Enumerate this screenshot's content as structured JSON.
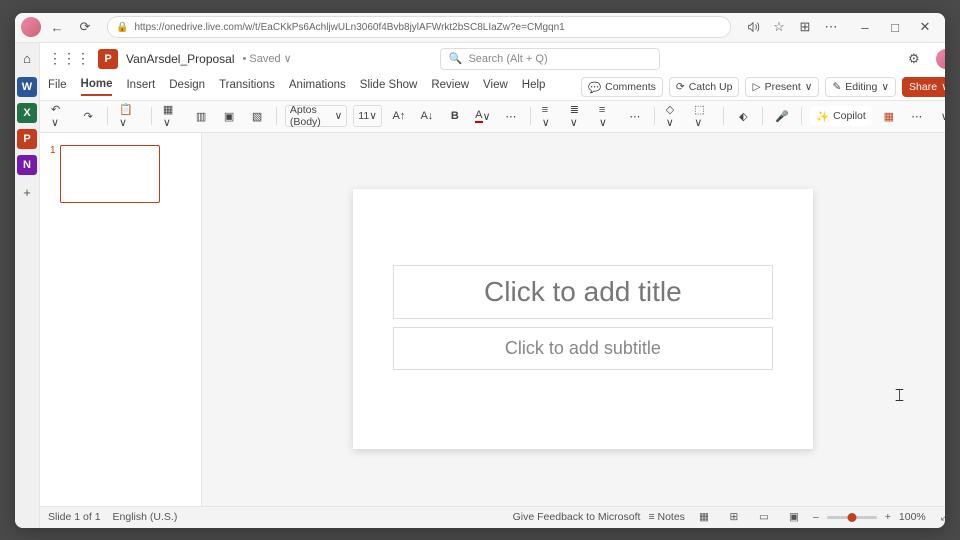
{
  "browser": {
    "url": "https://onedrive.live.com/w/t/EaCKkPs6AchljwULn3060f4Bvb8jylAFWrkt2bSC8LIaZw?e=CMgqn1"
  },
  "sidebar_apps": [
    {
      "label": "W",
      "color": "#2b579a"
    },
    {
      "label": "X",
      "color": "#217346"
    },
    {
      "label": "P",
      "color": "#c43e1c"
    },
    {
      "label": "N",
      "color": "#7719aa"
    }
  ],
  "title": {
    "app_initial": "P",
    "doc_name": "VanArsdel_Proposal",
    "saved_state": "• Saved ∨",
    "search_placeholder": "Search (Alt + Q)"
  },
  "tabs": [
    "File",
    "Home",
    "Insert",
    "Design",
    "Transitions",
    "Animations",
    "Slide Show",
    "Review",
    "View",
    "Help"
  ],
  "active_tab": "Home",
  "tab_buttons": {
    "comments": "Comments",
    "catchup": "Catch Up",
    "present": "Present",
    "editing": "Editing",
    "share": "Share"
  },
  "ribbon": {
    "font_name": "Aptos (Body)",
    "font_size": "11",
    "bold": "B",
    "copilot": "Copilot"
  },
  "slide": {
    "number": "1",
    "title_placeholder": "Click to add title",
    "subtitle_placeholder": "Click to add subtitle"
  },
  "status": {
    "slide_info": "Slide 1 of 1",
    "language": "English (U.S.)",
    "feedback": "Give Feedback to Microsoft",
    "notes": "Notes",
    "zoom": "100%"
  }
}
